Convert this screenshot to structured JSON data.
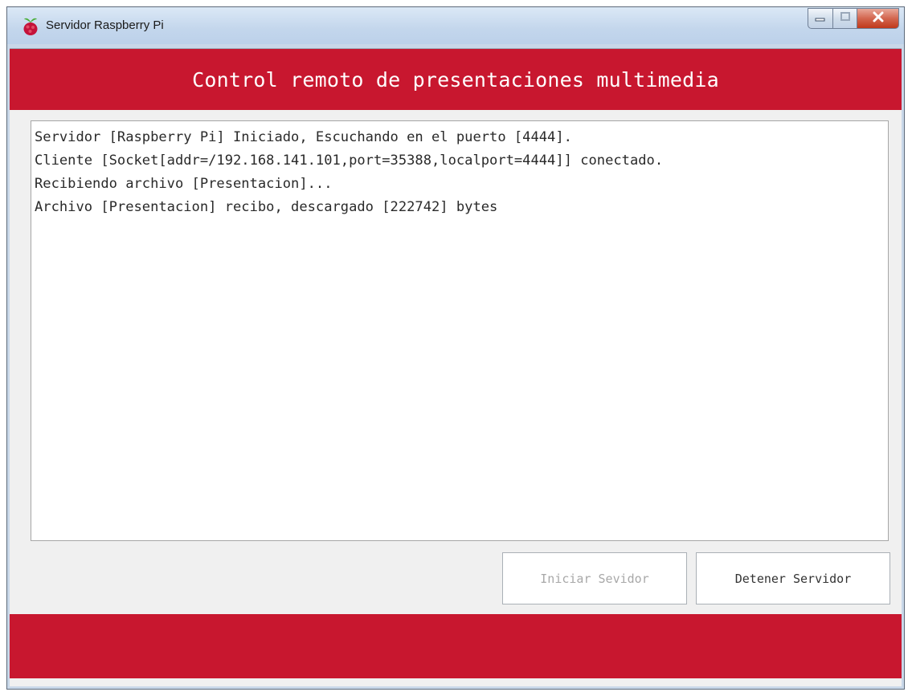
{
  "window": {
    "title": "Servidor Raspberry Pi",
    "icon": "raspberry-pi-icon",
    "controls": [
      "minimize-icon",
      "maximize-icon",
      "close-icon"
    ]
  },
  "header": {
    "title": "Control remoto de presentaciones multimedia"
  },
  "log": {
    "lines": [
      "Servidor [Raspberry Pi] Iniciado, Escuchando en el puerto [4444].",
      "Cliente [Socket[addr=/192.168.141.101,port=35388,localport=4444]] conectado.",
      "Recibiendo archivo [Presentacion]...",
      "Archivo [Presentacion] recibo, descargado [222742] bytes"
    ]
  },
  "buttons": {
    "start_label": "Iniciar Sevidor",
    "stop_label": "Detener Servidor"
  },
  "colors": {
    "brand_red": "#c8172f",
    "disabled_text": "#a8a8a8"
  }
}
